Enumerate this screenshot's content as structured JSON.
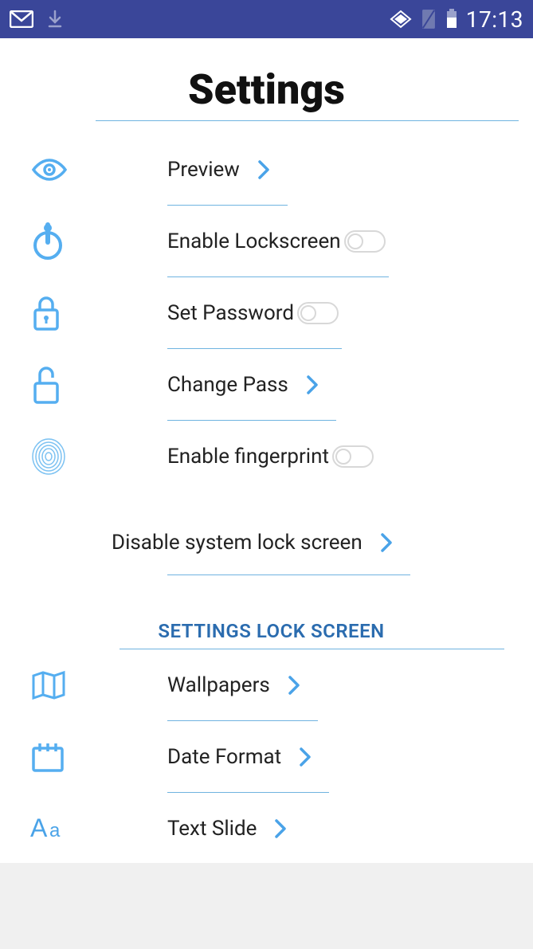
{
  "statusbar": {
    "time": "17:13"
  },
  "header": {
    "title": "Settings"
  },
  "section1": {
    "items": [
      {
        "icon": "eye",
        "label": "Preview",
        "action": "chevron"
      },
      {
        "icon": "power",
        "label": "Enable Lockscreen",
        "action": "toggle"
      },
      {
        "icon": "lock",
        "label": "Set Password",
        "action": "toggle"
      },
      {
        "icon": "unlock",
        "label": "Change Pass",
        "action": "chevron"
      },
      {
        "icon": "fingerprint",
        "label": "Enable fingerprint",
        "action": "toggle"
      }
    ],
    "disable_row": {
      "label": "Disable system lock screen",
      "action": "chevron"
    }
  },
  "section2": {
    "header": "SETTINGS LOCK SCREEN",
    "items": [
      {
        "icon": "map",
        "label": "Wallpapers",
        "action": "chevron"
      },
      {
        "icon": "calendar",
        "label": "Date Format",
        "action": "chevron"
      },
      {
        "icon": "aa",
        "label": "Text Slide",
        "action": "chevron"
      }
    ]
  }
}
